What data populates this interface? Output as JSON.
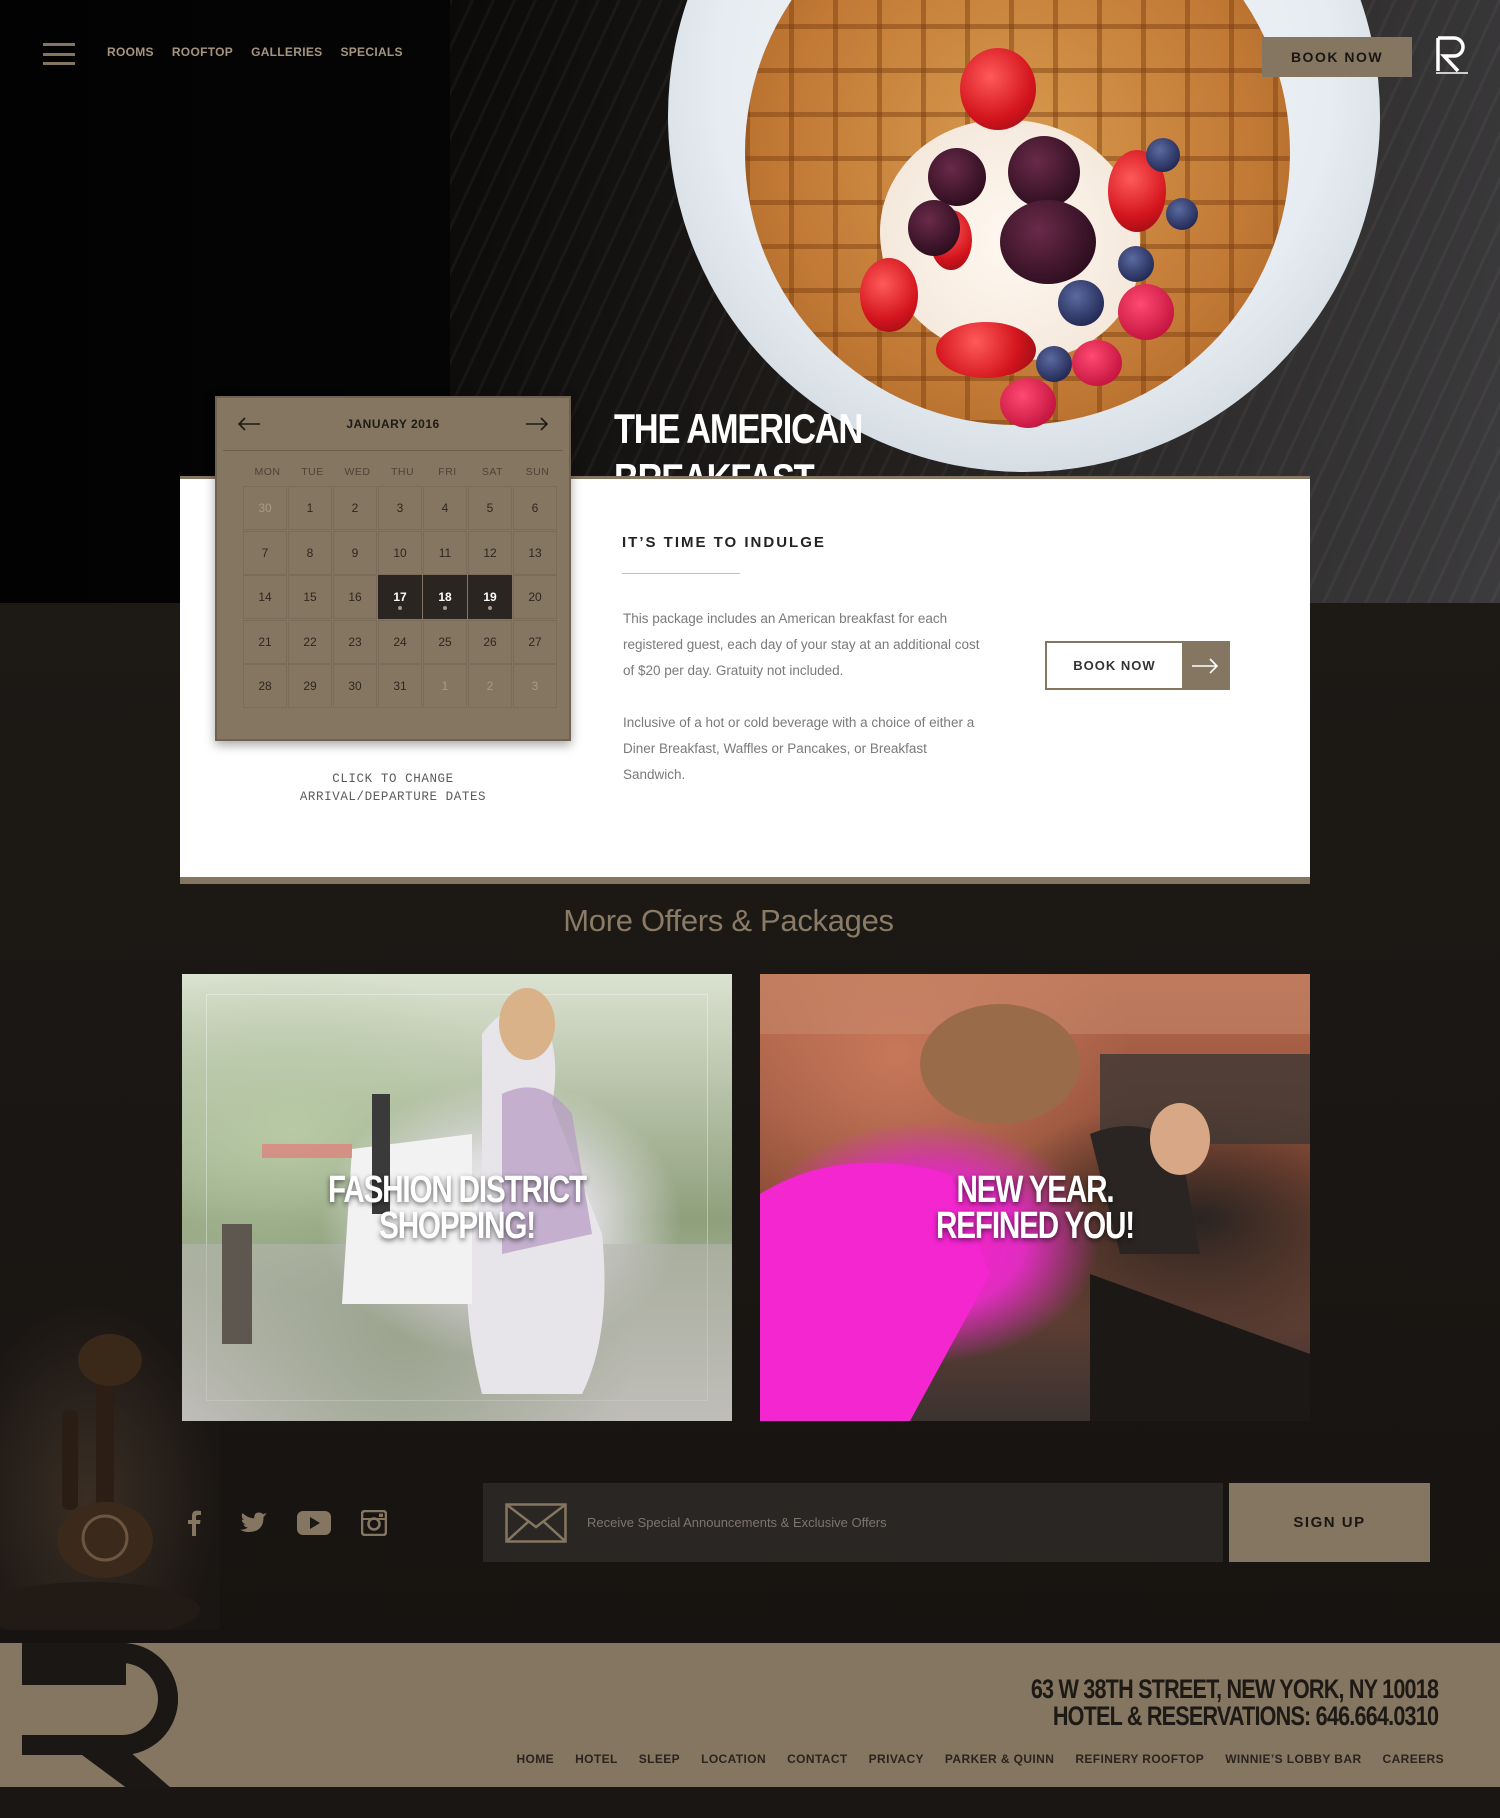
{
  "nav": {
    "items": [
      {
        "label": "ROOMS"
      },
      {
        "label": "ROOFTOP"
      },
      {
        "label": "GALLERIES"
      },
      {
        "label": "SPECIALS"
      }
    ],
    "book_now": "BOOK NOW",
    "menu_icon": "hamburger-icon",
    "logo_icon": "r-logo-icon"
  },
  "hero": {
    "title": "THE AMERICAN BREAKFAST"
  },
  "calendar": {
    "month": "JANUARY 2016",
    "prev_icon": "arrow-left-icon",
    "next_icon": "arrow-right-icon",
    "weekdays": [
      "MON",
      "TUE",
      "WED",
      "THU",
      "FRI",
      "SAT",
      "SUN"
    ],
    "days": [
      {
        "n": "30",
        "muted": true
      },
      {
        "n": "1"
      },
      {
        "n": "2"
      },
      {
        "n": "3"
      },
      {
        "n": "4"
      },
      {
        "n": "5"
      },
      {
        "n": "6"
      },
      {
        "n": "7"
      },
      {
        "n": "8"
      },
      {
        "n": "9"
      },
      {
        "n": "10"
      },
      {
        "n": "11"
      },
      {
        "n": "12"
      },
      {
        "n": "13"
      },
      {
        "n": "14"
      },
      {
        "n": "15"
      },
      {
        "n": "16"
      },
      {
        "n": "17",
        "selected": true
      },
      {
        "n": "18",
        "selected": true
      },
      {
        "n": "19",
        "selected": true
      },
      {
        "n": "20"
      },
      {
        "n": "21"
      },
      {
        "n": "22"
      },
      {
        "n": "23"
      },
      {
        "n": "24"
      },
      {
        "n": "25"
      },
      {
        "n": "26"
      },
      {
        "n": "27"
      },
      {
        "n": "28"
      },
      {
        "n": "29"
      },
      {
        "n": "30"
      },
      {
        "n": "31"
      },
      {
        "n": "1",
        "muted": true
      },
      {
        "n": "2",
        "muted": true
      },
      {
        "n": "3",
        "muted": true
      }
    ],
    "caption_line1": "CLICK TO CHANGE",
    "caption_line2": "ARRIVAL/DEPARTURE DATES"
  },
  "package": {
    "heading": "IT’S TIME TO INDULGE",
    "paragraph1": "This package includes an American breakfast for each registered guest, each day of your stay at an additional cost of $20 per day. Gratuity not included.",
    "paragraph2": "Inclusive of a hot or cold beverage with a choice of either a Diner Breakfast, Waffles or Pancakes, or Breakfast Sandwich.",
    "book_now": "BOOK NOW",
    "book_icon": "arrow-right-icon"
  },
  "offers": {
    "title": "More Offers & Packages",
    "items": [
      {
        "line1": "FASHION DISTRICT",
        "line2": "SHOPPING!"
      },
      {
        "line1": "NEW YEAR.",
        "line2": "REFINED YOU!"
      }
    ]
  },
  "social": {
    "icons": [
      "facebook-icon",
      "twitter-icon",
      "youtube-icon",
      "instagram-icon"
    ]
  },
  "signup": {
    "placeholder": "Receive Special Announcements & Exclusive Offers",
    "button": "SIGN UP",
    "icon": "envelope-icon"
  },
  "footer": {
    "address_line1": "63 W 38TH STREET, NEW YORK, NY 10018",
    "address_line2": "HOTEL & RESERVATIONS: 646.664.0310",
    "links": [
      "HOME",
      "HOTEL",
      "SLEEP",
      "LOCATION",
      "CONTACT",
      "PRIVACY",
      "PARKER & QUINN",
      "REFINERY ROOFTOP",
      "WINNIE’S LOBBY BAR",
      "CAREERS"
    ]
  },
  "colors": {
    "accent": "#857661",
    "background": "#1b1714",
    "card": "#ffffff",
    "selected_day": "#2a2520"
  }
}
